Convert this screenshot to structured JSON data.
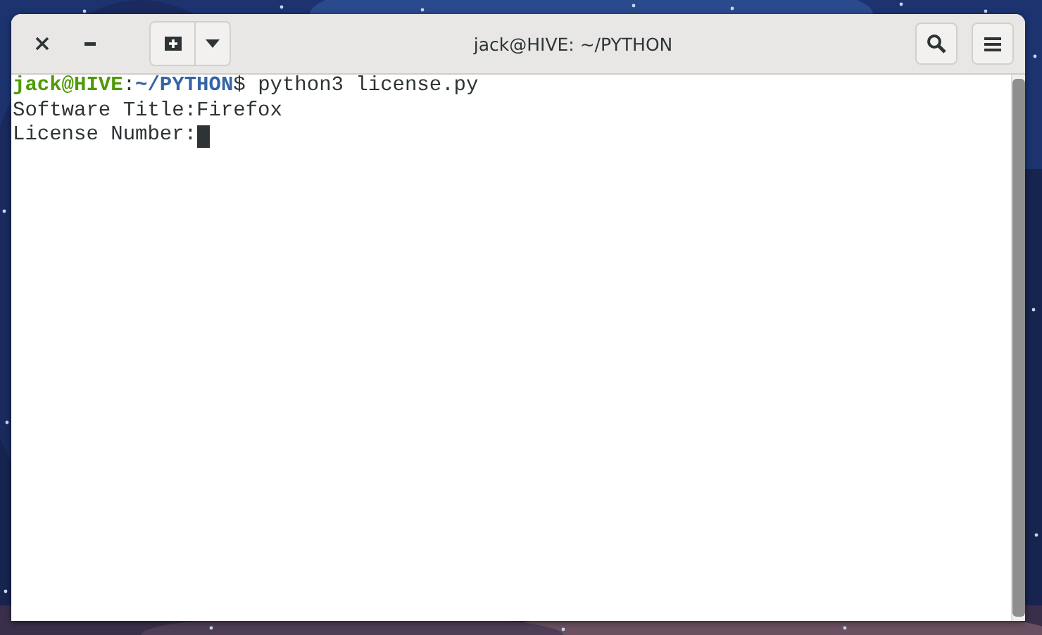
{
  "window": {
    "title": "jack@HIVE: ~/PYTHON"
  },
  "terminal": {
    "lines": [
      {
        "kind": "prompt",
        "user": "jack@HIVE",
        "separator": ":",
        "path": "~/PYTHON",
        "symbol": "$",
        "command": "python3 license.py"
      },
      {
        "kind": "output",
        "text": "Software Title:Firefox"
      },
      {
        "kind": "input",
        "text": "License Number:",
        "cursor": true
      }
    ]
  }
}
